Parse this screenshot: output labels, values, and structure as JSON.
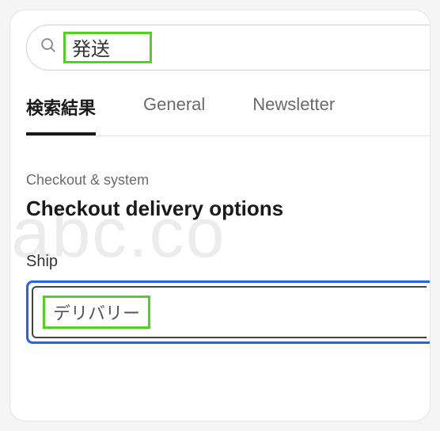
{
  "search": {
    "value": "発送"
  },
  "tabs": [
    {
      "label": "検索結果",
      "active": true
    },
    {
      "label": "General",
      "active": false
    },
    {
      "label": "Newsletter",
      "active": false
    }
  ],
  "section": {
    "category": "Checkout & system",
    "title": "Checkout delivery options"
  },
  "field": {
    "label": "Ship",
    "value": "デリバリー"
  },
  "watermark": "-abc.co",
  "colors": {
    "highlight_green": "#4CD41E",
    "focus_blue": "#2463EB"
  }
}
